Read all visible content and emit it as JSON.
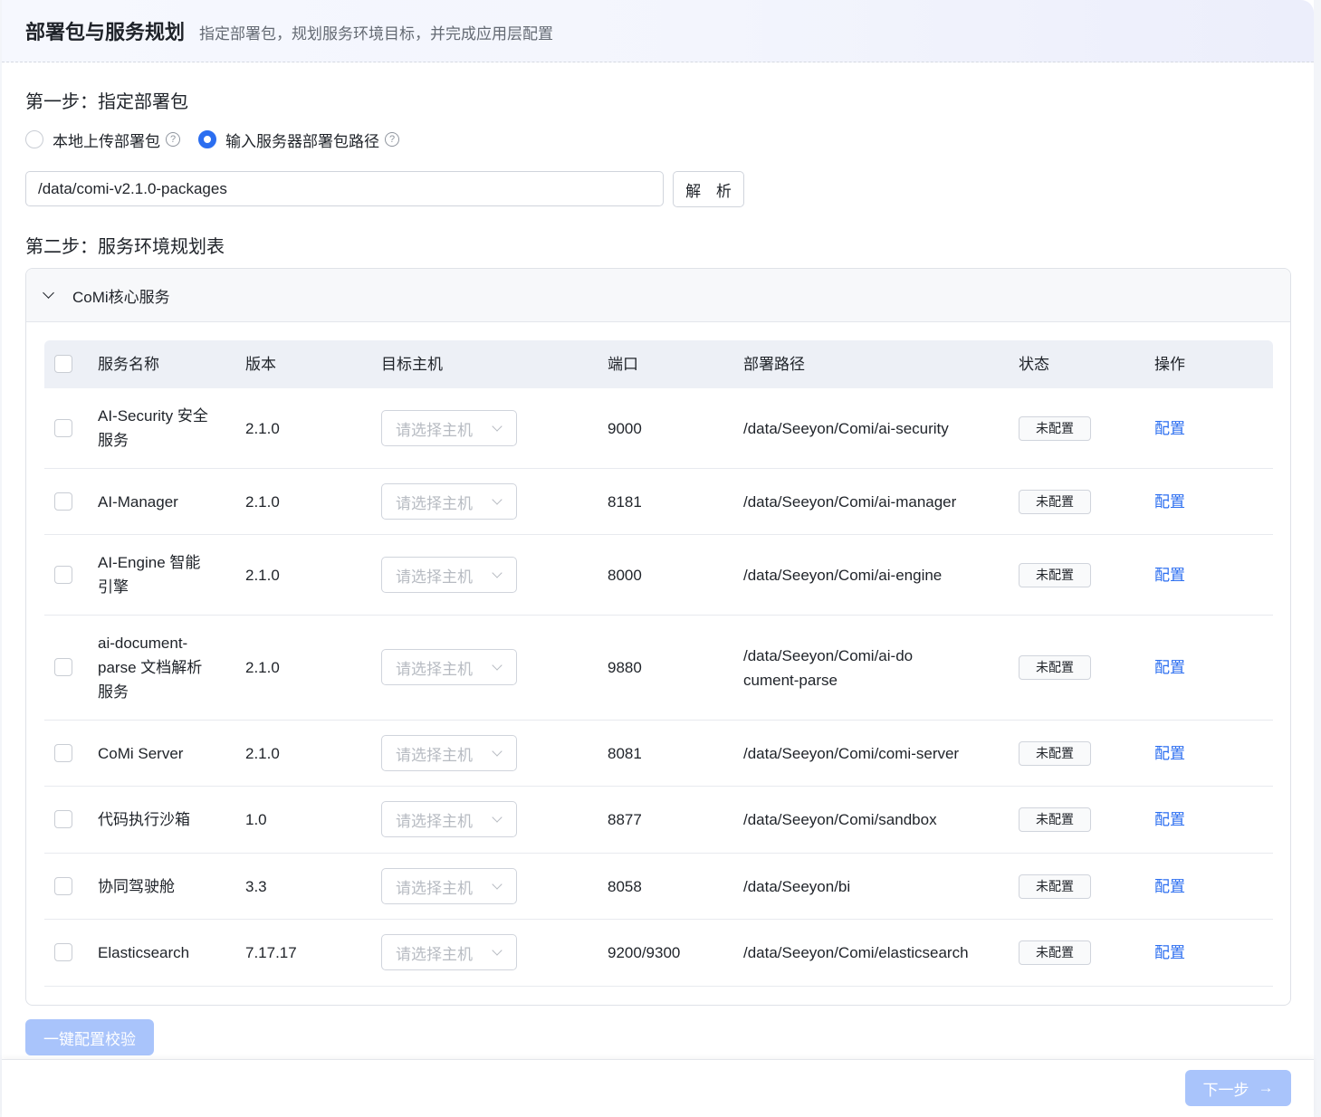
{
  "header": {
    "title": "部署包与服务规划",
    "subtitle": "指定部署包，规划服务环境目标，并完成应用层配置"
  },
  "step1": {
    "title": "第一步：指定部署包",
    "options": [
      {
        "label": "本地上传部署包",
        "checked": false
      },
      {
        "label": "输入服务器部署包路径",
        "checked": true
      }
    ],
    "path_value": "/data/comi-v2.1.0-packages",
    "parse_label": "解 析"
  },
  "step2": {
    "title": "第二步：服务环境规划表",
    "panel_title": "CoMi核心服务",
    "columns": {
      "name": "服务名称",
      "version": "版本",
      "host": "目标主机",
      "port": "端口",
      "path": "部署路径",
      "status": "状态",
      "action": "操作"
    },
    "rows": [
      {
        "name": "AI-Security 安全服务",
        "version": "2.1.0",
        "host_placeholder": "请选择主机",
        "port": "9000",
        "path": "/data/Seeyon/Comi/ai-security",
        "status": "未配置",
        "action": "配置"
      },
      {
        "name": "AI-Manager",
        "version": "2.1.0",
        "host_placeholder": "请选择主机",
        "port": "8181",
        "path": "/data/Seeyon/Comi/ai-manager",
        "status": "未配置",
        "action": "配置"
      },
      {
        "name": "AI-Engine 智能引擎",
        "version": "2.1.0",
        "host_placeholder": "请选择主机",
        "port": "8000",
        "path": "/data/Seeyon/Comi/ai-engine",
        "status": "未配置",
        "action": "配置"
      },
      {
        "name": "ai-document-parse 文档解析服务",
        "version": "2.1.0",
        "host_placeholder": "请选择主机",
        "port": "9880",
        "path": "/data/Seeyon/Comi/ai-document-parse",
        "status": "未配置",
        "action": "配置"
      },
      {
        "name": "CoMi Server",
        "version": "2.1.0",
        "host_placeholder": "请选择主机",
        "port": "8081",
        "path": "/data/Seeyon/Comi/comi-server",
        "status": "未配置",
        "action": "配置"
      },
      {
        "name": "代码执行沙箱",
        "version": "1.0",
        "host_placeholder": "请选择主机",
        "port": "8877",
        "path": "/data/Seeyon/Comi/sandbox",
        "status": "未配置",
        "action": "配置"
      },
      {
        "name": "协同驾驶舱",
        "version": "3.3",
        "host_placeholder": "请选择主机",
        "port": "8058",
        "path": "/data/Seeyon/bi",
        "status": "未配置",
        "action": "配置"
      },
      {
        "name": "Elasticsearch",
        "version": "7.17.17",
        "host_placeholder": "请选择主机",
        "port": "9200/9300",
        "path": "/data/Seeyon/Comi/elasticsearch",
        "status": "未配置",
        "action": "配置"
      }
    ]
  },
  "actions": {
    "verify_label": "一键配置校验",
    "next_label": "下一步"
  },
  "colors": {
    "accent": "#2b6ef0",
    "disabled_button": "#a9c4fb"
  }
}
